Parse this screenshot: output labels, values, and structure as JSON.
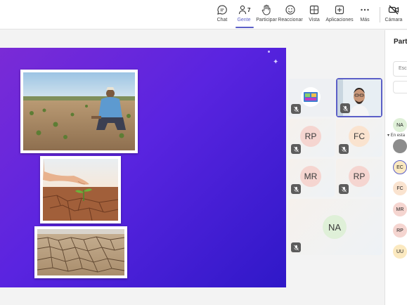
{
  "toolbar": {
    "buttons": [
      {
        "id": "chat",
        "label": "Chat"
      },
      {
        "id": "people",
        "label": "Gente",
        "count": "7"
      },
      {
        "id": "raise",
        "label": "Participar"
      },
      {
        "id": "react",
        "label": "Reaccionar"
      },
      {
        "id": "view",
        "label": "Vista"
      },
      {
        "id": "apps",
        "label": "Aplicaciones"
      },
      {
        "id": "more",
        "label": "Más"
      },
      {
        "id": "camera",
        "label": "Cámara"
      }
    ],
    "accent": "#5b5fc7"
  },
  "tiles": [
    {
      "initials": "RP",
      "color": "#f5d5d0"
    },
    {
      "initials": "FC",
      "color": "#fae3cf"
    },
    {
      "initials": "MR",
      "color": "#f5d5d0"
    },
    {
      "initials": "RP",
      "color": "#f5d5d0"
    },
    {
      "initials": "NA",
      "color": "#dff0d8"
    }
  ],
  "panel": {
    "title": "Partic",
    "search_placeholder": "Escr",
    "section": "En esta",
    "participants": [
      {
        "initials": "NA",
        "color": "#dff0d8"
      },
      {
        "initials": "",
        "color": "#8c8c8c"
      },
      {
        "initials": "EC",
        "color": "#fbe9c0"
      },
      {
        "initials": "FC",
        "color": "#fae3cf"
      },
      {
        "initials": "MR",
        "color": "#f5d5d0"
      },
      {
        "initials": "RP",
        "color": "#f5d5d0"
      },
      {
        "initials": "UU",
        "color": "#fbe9c0"
      }
    ]
  }
}
